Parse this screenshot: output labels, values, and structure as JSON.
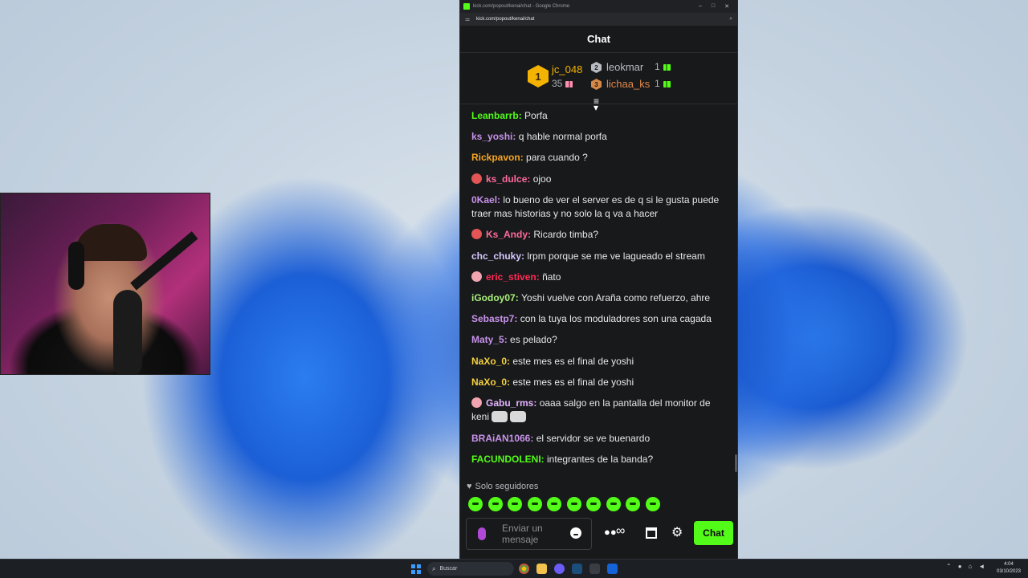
{
  "browser": {
    "title": "kick.com/popout/kenai/chat - Google Chrome",
    "url": "kick.com/popout/kenai/chat",
    "controls": [
      "–",
      "□",
      "✕"
    ]
  },
  "chat": {
    "title": "Chat",
    "leaderboard": {
      "first": {
        "rank": "1",
        "name": "jc_048",
        "count": "35"
      },
      "second": {
        "rank": "2",
        "name": "leokmar",
        "count": "1"
      },
      "third": {
        "rank": "3",
        "name": "lichaa_ks",
        "count": "1"
      }
    },
    "messages": [
      {
        "user": "Leanbarrb",
        "color": "#53fc18",
        "text": "Porfa",
        "badge": null
      },
      {
        "user": "ks_yoshi",
        "color": "#c792ea",
        "text": "q hable normal porfa",
        "badge": null
      },
      {
        "user": "Rickpavon",
        "color": "#f5a623",
        "text": "para cuando ?",
        "badge": null
      },
      {
        "user": "ks_dulce",
        "color": "#ff6b9a",
        "text": "ojoo",
        "badge": "#e25555"
      },
      {
        "user": "0Kael",
        "color": "#c792ea",
        "text": "lo bueno de ver el server es de q si le gusta puede traer mas historias y no solo la q va a hacer",
        "badge": null
      },
      {
        "user": "Ks_Andy",
        "color": "#ff6b9a",
        "text": "Ricardo timba?",
        "badge": "#e25555"
      },
      {
        "user": "chc_chuky",
        "color": "#d7c9ff",
        "text": "lrpm porque se me ve lagueado el stream",
        "badge": null
      },
      {
        "user": "eric_stiven",
        "color": "#ff2a55",
        "text": "ñato",
        "badge": "#f0a5b0"
      },
      {
        "user": "iGodoy07",
        "color": "#aaf07a",
        "text": "Yoshi vuelve con Araña como refuerzo, ahre",
        "badge": null
      },
      {
        "user": "Sebastp7",
        "color": "#c792ea",
        "text": "con la tuya los moduladores son una cagada",
        "badge": null
      },
      {
        "user": "Maty_5",
        "color": "#c792ea",
        "text": "es pelado?",
        "badge": null
      },
      {
        "user": "NaXo_0",
        "color": "#f5d142",
        "text": "este mes es el final de yoshi",
        "badge": null
      },
      {
        "user": "NaXo_0",
        "color": "#f5d142",
        "text": "este mes es el final de yoshi",
        "badge": null
      },
      {
        "user": "Gabu_rms",
        "color": "#e3b3ff",
        "text": "oaaa salgo en la pantalla del monitor de keni",
        "badge": "#f0a5b0",
        "emotes": 2
      },
      {
        "user": "BRAiAN1066",
        "color": "#c792ea",
        "text": "el servidor se ve buenardo",
        "badge": null
      },
      {
        "user": "FACUNDOLENI",
        "color": "#53fc18",
        "text": "integrantes de la banda?",
        "badge": null
      }
    ],
    "followers_mode": "Solo seguidores",
    "input_placeholder": "Enviar un mensaje",
    "send_label": "Chat",
    "accent": "#53fc18"
  },
  "taskbar": {
    "search_placeholder": "Buscar",
    "time": "4:04",
    "date": "03/10/2023"
  }
}
